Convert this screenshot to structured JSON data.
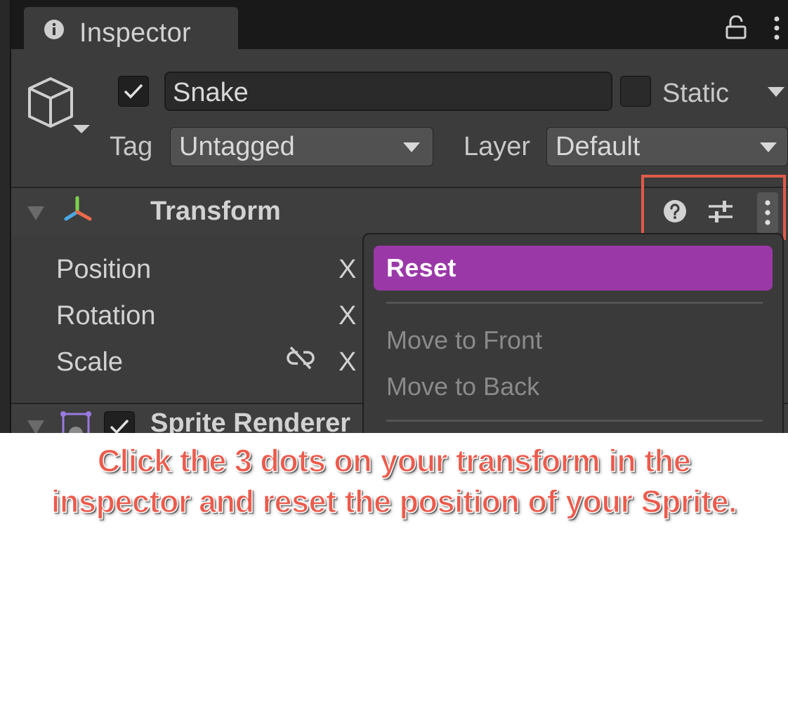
{
  "window": {
    "tab_label": "Inspector",
    "tab_icon": "info-icon",
    "lock_icon": "lock-icon",
    "menu_icon": "kebab-icon"
  },
  "gameobject": {
    "icon": "cube-icon",
    "active": true,
    "name": "Snake",
    "static_label": "Static",
    "static_checked": false,
    "tag_label": "Tag",
    "tag_value": "Untagged",
    "layer_label": "Layer",
    "layer_value": "Default"
  },
  "transform": {
    "title": "Transform",
    "icon": "transform-axis-icon",
    "header_icons": [
      "help-icon",
      "presets-icon",
      "kebab-icon"
    ],
    "rows": [
      {
        "label": "Position",
        "axis": "X"
      },
      {
        "label": "Rotation",
        "axis": "X"
      },
      {
        "label": "Scale",
        "axis": "X",
        "icon": "unlink-icon"
      }
    ]
  },
  "sprite_renderer": {
    "title": "Sprite Renderer",
    "enabled": true,
    "icon": "sprite-renderer-icon"
  },
  "context_menu": {
    "selected": "Reset",
    "items": [
      "Reset",
      "Move to Front",
      "Move to Back"
    ]
  },
  "caption": {
    "line1": "Click the 3 dots on your transform in the",
    "line2": "inspector and reset the position of your Sprite."
  },
  "colors": {
    "menu_highlight": "#9b38a8",
    "annotation": "#ec5b4c",
    "panel_bg": "#3c3c3c"
  }
}
